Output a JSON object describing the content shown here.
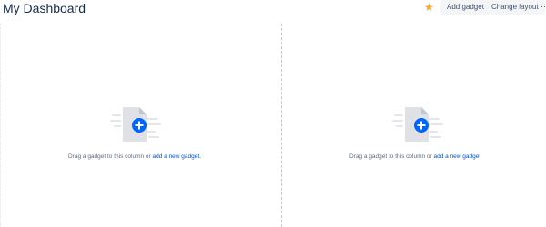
{
  "header": {
    "title": "My Dashboard",
    "star_icon": "star-icon",
    "star_color": "#f5a623",
    "add_gadget_label": "Add gadget",
    "change_layout_label": "Change layout",
    "more_label": "···"
  },
  "columns": [
    {
      "illustration_icon": "add-gadget-illustration-icon",
      "drop_text": "Drag a gadget to this column or ",
      "link_text": "add a new gadget."
    },
    {
      "illustration_icon": "add-gadget-illustration-icon",
      "drop_text": "Drag a gadget to this column or ",
      "link_text": "add a new gadget"
    }
  ],
  "colors": {
    "accent": "#0052cc",
    "divider": "#c1c7d0"
  }
}
